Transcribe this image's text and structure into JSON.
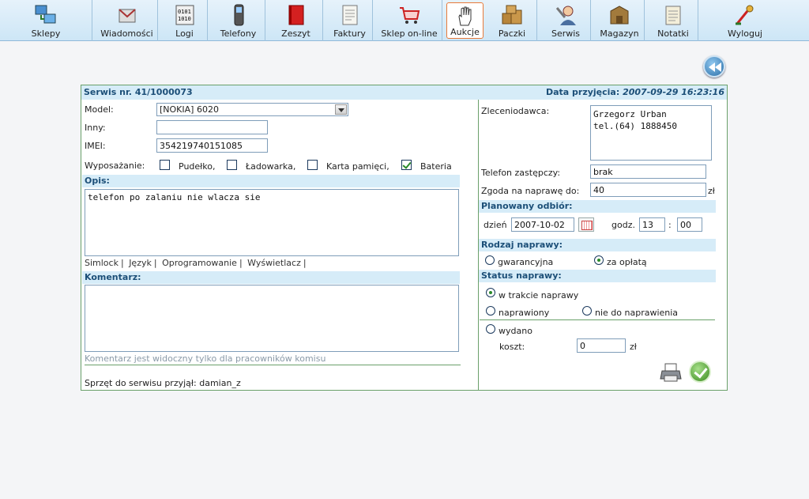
{
  "toolbar": {
    "items": [
      {
        "label": "Sklepy",
        "icon": "shops-icon"
      },
      {
        "label": "Wiadomości",
        "icon": "messages-icon"
      },
      {
        "label": "Logi",
        "icon": "logs-icon"
      },
      {
        "label": "Telefony",
        "icon": "phone-icon"
      },
      {
        "label": "Zeszyt",
        "icon": "notebook-icon"
      },
      {
        "label": "Faktury",
        "icon": "invoice-icon"
      },
      {
        "label": "Sklep on-line",
        "icon": "cart-icon"
      },
      {
        "label": "Aukcje",
        "icon": "hand-icon"
      },
      {
        "label": "Paczki",
        "icon": "packages-icon"
      },
      {
        "label": "Serwis",
        "icon": "service-icon"
      },
      {
        "label": "Magazyn",
        "icon": "warehouse-icon"
      },
      {
        "label": "Notatki",
        "icon": "notes-icon"
      },
      {
        "label": "Wyloguj",
        "icon": "logout-icon"
      }
    ],
    "active": "Aukcje"
  },
  "header": {
    "service_number": "Serwis nr. 41/1000073",
    "received_label": "Data przyjęcia:",
    "received_date": "2007-09-29 16:23:16"
  },
  "left": {
    "model_label": "Model:",
    "model_value": "[NOKIA] 6020",
    "other_label": "Inny:",
    "other_value": "",
    "imei_label": "IMEI:",
    "imei_value": "354219740151085",
    "equipment_label": "Wyposażanie:",
    "equipment": [
      {
        "label": "Pudełko,",
        "checked": false
      },
      {
        "label": "Ładowarka,",
        "checked": false
      },
      {
        "label": "Karta pamięci,",
        "checked": false
      },
      {
        "label": "Bateria",
        "checked": true
      }
    ],
    "description_title": "Opis:",
    "description_text": "telefon po zalaniu nie wlacza sie",
    "quick_links": [
      "Simlock",
      "|",
      "Język",
      "|",
      "Oprogramowanie",
      "|",
      "Wyświetlacz",
      "|"
    ],
    "comment_title": "Komentarz:",
    "comment_text": "",
    "comment_hint": "Komentarz jest widoczny tylko dla pracowników komisu",
    "accepted_by": "Sprzęt do serwisu przyjął: damian_z"
  },
  "right": {
    "client_label": "Zleceniodawca:",
    "client_value": "Grzegorz Urban\ntel.(64) 1888450",
    "replacement_label": "Telefon zastępczy:",
    "replacement_value": "brak",
    "consent_label": "Zgoda na naprawę do:",
    "consent_value": "40",
    "currency": "zł",
    "pickup_title": "Planowany odbiór:",
    "day_label": "dzień",
    "day_value": "2007-10-02",
    "hour_label": "godz.",
    "hour_value": "13",
    "colon": ":",
    "minute_value": "00",
    "repair_type_title": "Rodzaj naprawy:",
    "repair_types": [
      {
        "label": "gwarancyjna",
        "selected": false
      },
      {
        "label": "za opłatą",
        "selected": true
      }
    ],
    "status_title": "Status naprawy:",
    "statuses": [
      {
        "label": "w trakcie naprawy",
        "selected": true
      },
      {
        "label": "naprawiony",
        "selected": false
      },
      {
        "label": "nie do naprawienia",
        "selected": false
      },
      {
        "label": "wydano",
        "selected": false
      }
    ],
    "cost_label": "koszt:",
    "cost_value": "0",
    "cost_currency": "zł"
  }
}
